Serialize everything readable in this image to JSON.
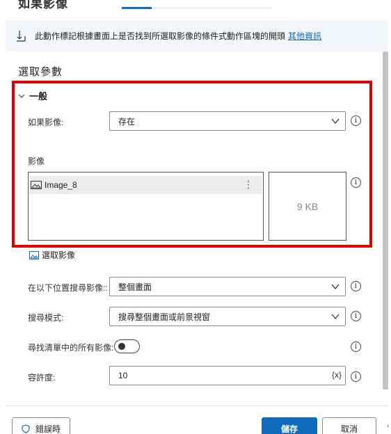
{
  "header": {
    "title_fragment": "如果影像"
  },
  "info": {
    "text": "此動作標記根據畫面上是否找到所選取影像的條件式動作區塊的開頭",
    "link": "其他資訊"
  },
  "section": {
    "title": "選取參數"
  },
  "group": {
    "title": "一般"
  },
  "fields": {
    "if_image": {
      "label": "如果影像:",
      "value": "存在"
    },
    "image": {
      "label": "影像",
      "items": [
        "Image_8"
      ],
      "preview_size": "9 KB",
      "select_link": "選取影像"
    },
    "search_location": {
      "label": "在以下位置搜尋影像::",
      "value": "整個畫面"
    },
    "search_mode": {
      "label": "搜尋模式:",
      "value": "搜尋整個畫面或前景視窗"
    },
    "find_all": {
      "label": "尋找清單中的所有影像:",
      "on": false
    },
    "tolerance": {
      "label": "容許度:",
      "value": "10",
      "var_button": "{x}"
    }
  },
  "footer": {
    "error_button": "錯誤時",
    "save_button": "儲存",
    "cancel_button": "取消"
  },
  "icons": {
    "info": "i",
    "more": "⋮"
  },
  "colors": {
    "accent": "#0f6cbd",
    "highlight": "#e00000"
  }
}
